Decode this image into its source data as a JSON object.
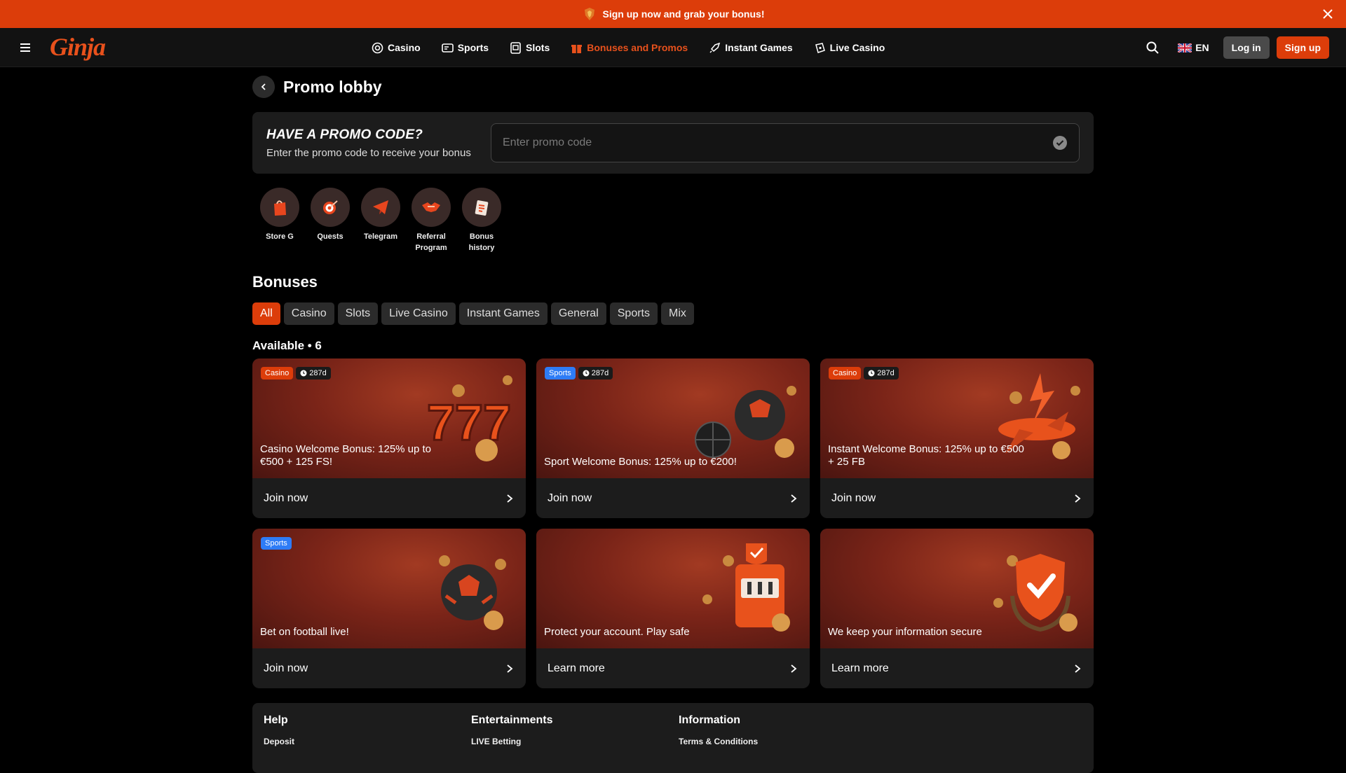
{
  "banner": {
    "text": "Sign up now and grab your bonus!",
    "icon": "badge-icon"
  },
  "nav": {
    "logo": "Ginja",
    "links": [
      {
        "label": "Casino",
        "icon": "casino-chip-icon",
        "active": false
      },
      {
        "label": "Sports",
        "icon": "ticket-icon",
        "active": false
      },
      {
        "label": "Slots",
        "icon": "slots-icon",
        "active": false
      },
      {
        "label": "Bonuses and Promos",
        "icon": "gift-icon",
        "active": true
      },
      {
        "label": "Instant Games",
        "icon": "rocket-icon",
        "active": false
      },
      {
        "label": "Live Casino",
        "icon": "live-casino-icon",
        "active": false
      }
    ],
    "lang": "EN",
    "login": "Log in",
    "signup": "Sign up"
  },
  "page": {
    "title": "Promo lobby"
  },
  "promo": {
    "heading": "HAVE A PROMO CODE?",
    "sub": "Enter the promo code to receive your bonus",
    "placeholder": "Enter promo code"
  },
  "shortcuts": [
    {
      "label": "Store G",
      "icon": "store-bag-icon"
    },
    {
      "label": "Quests",
      "icon": "target-icon"
    },
    {
      "label": "Telegram",
      "icon": "telegram-icon"
    },
    {
      "label": "Referral Program",
      "icon": "handshake-icon"
    },
    {
      "label": "Bonus history",
      "icon": "bonus-history-icon"
    }
  ],
  "bonuses": {
    "title": "Bonuses",
    "filters": [
      "All",
      "Casino",
      "Slots",
      "Live Casino",
      "Instant Games",
      "General",
      "Sports",
      "Mix"
    ],
    "active_filter": "All",
    "available_label": "Available • 6",
    "cards": [
      {
        "category": "Casino",
        "timer": "287d",
        "title": "Casino Welcome Bonus: 125% up to €500 + 125 FS!",
        "action": "Join now",
        "art": "777-icon"
      },
      {
        "category": "Sports",
        "timer": "287d",
        "title": "Sport Welcome Bonus: 125% up to €200!",
        "action": "Join now",
        "art": "balls-icon"
      },
      {
        "category": "Casino",
        "timer": "287d",
        "title": "Instant Welcome Bonus: 125% up to €500 + 25 FB",
        "action": "Join now",
        "art": "plane-icon"
      },
      {
        "category": "Sports",
        "timer": "",
        "title": "Bet on football live!",
        "action": "Join now",
        "art": "football-icon"
      },
      {
        "category": "",
        "timer": "",
        "title": "Protect your account. Play safe",
        "action": "Learn more",
        "art": "slot-machine-icon"
      },
      {
        "category": "",
        "timer": "",
        "title": "We keep your information secure",
        "action": "Learn more",
        "art": "shield-icon"
      }
    ]
  },
  "footer": {
    "cols": [
      {
        "head": "Help",
        "link": "Deposit"
      },
      {
        "head": "Entertainments",
        "link": "LIVE Betting"
      },
      {
        "head": "Information",
        "link": "Terms & Conditions"
      }
    ]
  },
  "colors": {
    "accent": "#dc3d0a",
    "sports_badge": "#2e7cf6",
    "background": "#000000",
    "surface": "#1c1c1c"
  }
}
